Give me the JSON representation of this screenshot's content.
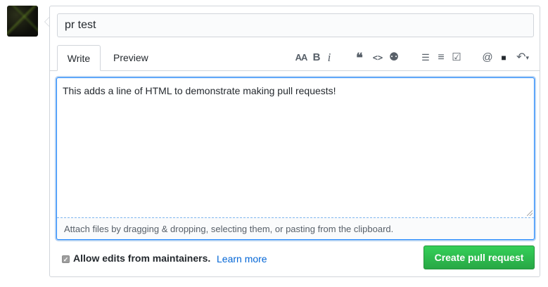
{
  "title_input": {
    "value": "pr test"
  },
  "tabs": {
    "write": "Write",
    "preview": "Preview"
  },
  "toolbar": {
    "header": "AA",
    "bold": "B",
    "italic": "i",
    "quote": "❝",
    "code": "<>",
    "link": "⚉",
    "bullet_list": "☰",
    "numbered_list": "≡",
    "task_list": "☑",
    "mention": "@",
    "reference": "■",
    "reply": "↶"
  },
  "body": {
    "text": "This adds a line of HTML to demonstrate making pull requests!",
    "attach_hint": "Attach files by dragging & dropping, selecting them, or pasting from the clipboard."
  },
  "footer": {
    "checkbox_checked": true,
    "allow_edits_label": "Allow edits from maintainers.",
    "learn_more": "Learn more",
    "create_button": "Create pull request"
  },
  "colors": {
    "accent": "#0366d6",
    "create_button": "#2cbe4e",
    "focus": "#2188ff"
  }
}
